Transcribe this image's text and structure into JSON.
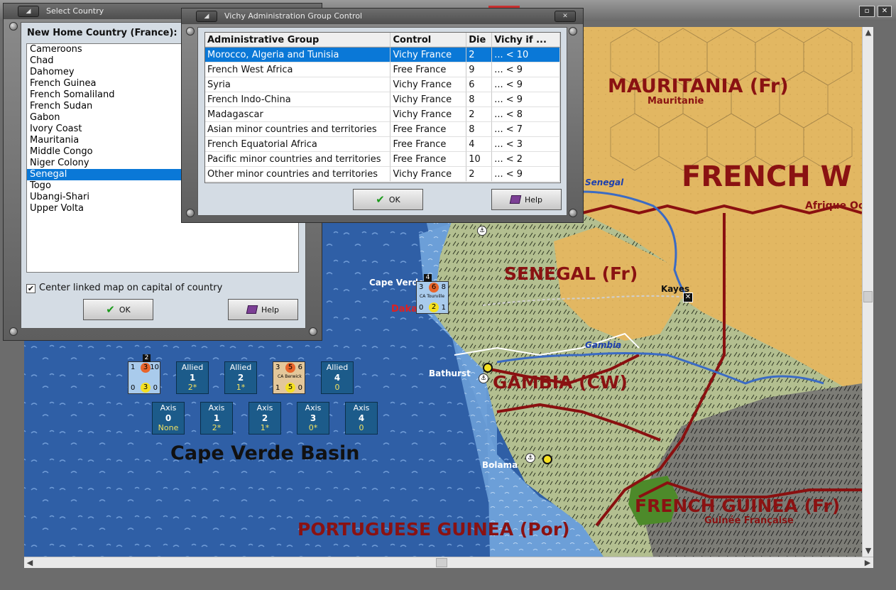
{
  "select_country": {
    "title": "Select Country",
    "label": "New Home Country (France):",
    "countries": [
      "Cameroons",
      "Chad",
      "Dahomey",
      "French Guinea",
      "French Somaliland",
      "French Sudan",
      "Gabon",
      "Ivory Coast",
      "Mauritania",
      "Middle Congo",
      "Niger Colony",
      "Senegal",
      "Togo",
      "Ubangi-Shari",
      "Upper Volta"
    ],
    "selected": "Senegal",
    "checkbox_label": "Center linked map on capital of country",
    "checkbox_checked": true,
    "ok_label": "OK",
    "help_label": "Help"
  },
  "vichy": {
    "title": "Vichy Administration Group Control",
    "headers": [
      "Administrative Group",
      "Control",
      "Die",
      "Vichy if ..."
    ],
    "rows": [
      [
        "Morocco, Algeria and Tunisia",
        "Vichy France",
        "2",
        "... < 10"
      ],
      [
        "French West Africa",
        "Free France",
        "9",
        "... < 9"
      ],
      [
        "Syria",
        "Vichy France",
        "6",
        "... < 9"
      ],
      [
        "French Indo-China",
        "Vichy France",
        "8",
        "... < 9"
      ],
      [
        "Madagascar",
        "Vichy France",
        "2",
        "... < 8"
      ],
      [
        "Asian minor countries and territories",
        "Free France",
        "8",
        "... < 7"
      ],
      [
        "French Equatorial Africa",
        "Free France",
        "4",
        "... < 3"
      ],
      [
        "Pacific minor countries and territories",
        "Free France",
        "10",
        "... < 2"
      ],
      [
        "Other minor countries and territories",
        "Vichy France",
        "2",
        "... < 9"
      ]
    ],
    "ok_label": "OK",
    "help_label": "Help"
  },
  "map": {
    "regions": {
      "mauritania": "MAURITANIA (Fr)",
      "mauritania_sub": "Mauritanie",
      "french_w": "FRENCH W",
      "afrique": "Afrique Oc",
      "senegal": "SENEGAL (Fr)",
      "gambia": "GAMBIA (CW)",
      "french_guinea": "FRENCH GUINEA (Fr)",
      "french_guinea_sub": "Guinée Française",
      "port_guinea": "PORTUGUESE GUINEA (Por)",
      "basin": "Cape Verde Basin"
    },
    "cities": {
      "cape_verde": "Cape Verde",
      "dakar": "Dakar",
      "kayes": "Kayes",
      "bathurst": "Bathurst",
      "bolama": "Bolama"
    },
    "rivers": {
      "senegal": "Senegal",
      "gambia": "Gambia"
    },
    "allied_boxes": [
      {
        "side": "Allied",
        "num": "1",
        "val": "2*"
      },
      {
        "side": "Allied",
        "num": "2",
        "val": "1*"
      },
      {
        "side": "Allied",
        "num": "4",
        "val": "0"
      }
    ],
    "axis_boxes": [
      {
        "side": "Axis",
        "num": "0",
        "val": "None"
      },
      {
        "side": "Axis",
        "num": "1",
        "val": "2*"
      },
      {
        "side": "Axis",
        "num": "2",
        "val": "1*"
      },
      {
        "side": "Axis",
        "num": "3",
        "val": "0*"
      },
      {
        "side": "Axis",
        "num": "4",
        "val": "0"
      }
    ],
    "unit_tourville": {
      "name": "CA Tourville",
      "a": "3",
      "b": "6",
      "c": "8",
      "d": "0",
      "e": "2",
      "f": "1",
      "stack": "4"
    },
    "unit_berwick": {
      "name": "CA Berwick",
      "a": "3",
      "b": "5",
      "c": "6",
      "d": "1",
      "e": "5",
      "f": "0"
    },
    "unit_stack": {
      "a": "1",
      "b": "3",
      "c": "10",
      "d": "0",
      "e": "3",
      "f": "0",
      "stack": "2"
    }
  }
}
